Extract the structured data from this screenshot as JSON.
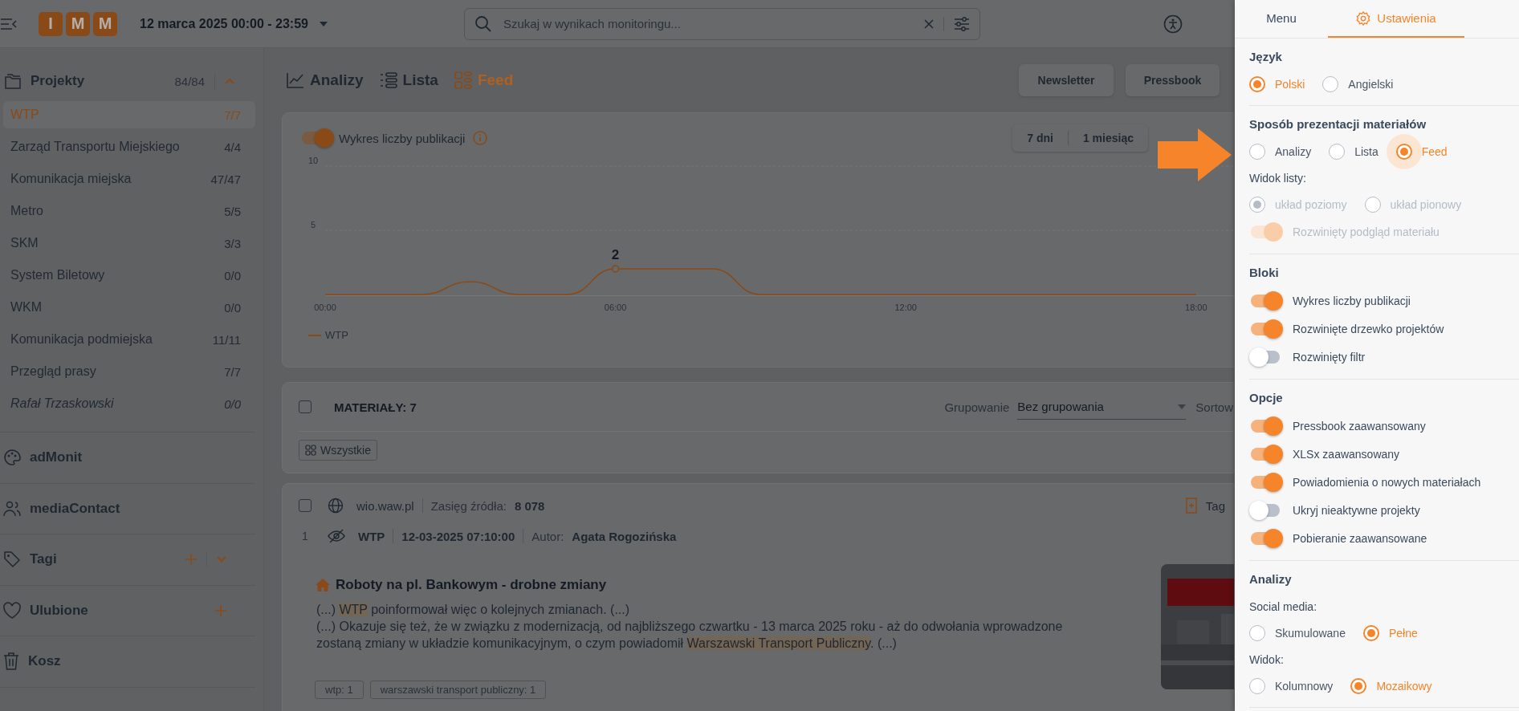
{
  "header": {
    "logo": [
      "I",
      "M",
      "M"
    ],
    "date_range": "12 marca 2025 00:00 - 23:59",
    "search": {
      "placeholder": "Szukaj w wynikach monitoringu..."
    }
  },
  "sidebar": {
    "projects": {
      "title": "Projekty",
      "count": "84/84",
      "expanded": true,
      "items": [
        {
          "name": "WTP",
          "count": "7/7",
          "selected": true,
          "inactive": false
        },
        {
          "name": "Zarząd Transportu Miejskiego",
          "count": "4/4",
          "selected": false,
          "inactive": false
        },
        {
          "name": "Komunikacja miejska",
          "count": "47/47",
          "selected": false,
          "inactive": false
        },
        {
          "name": "Metro",
          "count": "5/5",
          "selected": false,
          "inactive": false
        },
        {
          "name": "SKM",
          "count": "3/3",
          "selected": false,
          "inactive": false
        },
        {
          "name": "System Biletowy",
          "count": "0/0",
          "selected": false,
          "inactive": false
        },
        {
          "name": "WKM",
          "count": "0/0",
          "selected": false,
          "inactive": false
        },
        {
          "name": "Komunikacja podmiejska",
          "count": "11/11",
          "selected": false,
          "inactive": false
        },
        {
          "name": "Przegląd prasy",
          "count": "7/7",
          "selected": false,
          "inactive": false
        },
        {
          "name": "Rafał Trzaskowski",
          "count": "0/0",
          "selected": false,
          "inactive": true
        }
      ]
    },
    "sections": [
      {
        "kind": "admonit",
        "label": "adMonit",
        "add": false,
        "collapsible": false
      },
      {
        "kind": "contacts",
        "label": "mediaContact",
        "add": false,
        "collapsible": false
      },
      {
        "kind": "tags",
        "label": "Tagi",
        "add": true,
        "collapsible": true
      },
      {
        "kind": "favorites",
        "label": "Ulubione",
        "add": true,
        "collapsible": false
      },
      {
        "kind": "trash",
        "label": "Kosz",
        "add": false,
        "collapsible": false
      }
    ]
  },
  "view_tabs": [
    {
      "kind": "chart",
      "label": "Analizy",
      "selected": false
    },
    {
      "kind": "list",
      "label": "Lista",
      "selected": false
    },
    {
      "kind": "feed",
      "label": "Feed",
      "selected": true
    }
  ],
  "actions": [
    "Newsletter",
    "Pressbook"
  ],
  "chart_card": {
    "toggle": {
      "label": "Wykres liczby publikacji",
      "on": true
    },
    "ranges": [
      "7 dni",
      "1 miesiąc"
    ],
    "chart_data": {
      "type": "line",
      "x": [
        0,
        1,
        2,
        3,
        4,
        5,
        6,
        7,
        8,
        9,
        10,
        11,
        12,
        13,
        14,
        15,
        16,
        17,
        18
      ],
      "xlim": [
        0,
        18.8
      ],
      "ylim": [
        0,
        10
      ],
      "yticks": [
        5,
        10
      ],
      "xticks": [
        {
          "value": 0,
          "label": "00:00"
        },
        {
          "value": 6,
          "label": "06:00"
        },
        {
          "value": 12,
          "label": "12:00"
        },
        {
          "value": 18,
          "label": "18:00"
        }
      ],
      "series": [
        {
          "name": "WTP",
          "color": "#8a4a18",
          "values": [
            0,
            0,
            0,
            1,
            0,
            0,
            2,
            2,
            2,
            0,
            0,
            0,
            0,
            0,
            0,
            0,
            0,
            0,
            0
          ]
        }
      ],
      "annotations": [
        {
          "x": 6,
          "y": 2,
          "text": "2"
        }
      ]
    }
  },
  "materials": {
    "checked": false,
    "title": "MATERIAŁY: 7",
    "grouping_label": "Grupowanie",
    "grouping_value": "Bez grupowania",
    "sorting_label": "Sortow",
    "filter_chip": "Wszystkie"
  },
  "articles": [
    {
      "checked": false,
      "number": "1",
      "source": "wio.waw.pl",
      "reach_label": "Zasięg źródła:",
      "reach": "8 078",
      "tag_action": "Tag",
      "project": "WTP",
      "date": "12-03-2025 07:10:00",
      "author_label": "Autor:",
      "author": "Agata Rogozińska",
      "title": "Roboty na pl. Bankowym - drobne zmiany",
      "excerpt": [
        [
          {
            "text": "(...) ",
            "highlight": false
          },
          {
            "text": "WTP",
            "highlight": true
          },
          {
            "text": " poinformował więc o kolejnych zmianach. (...)",
            "highlight": false
          }
        ],
        [
          {
            "text": "(...) Okazuje się też, że w związku z modernizacją, od najbliższego czwartku - 13 marca 2025 roku - aż do odwołania wprowadzone zostaną zmiany w układzie komunikacyjnym, o czym powiadomił ",
            "highlight": false
          },
          {
            "text": "Warszawski Transport Publiczny",
            "highlight": true
          },
          {
            "text": ". (...)",
            "highlight": false
          }
        ]
      ],
      "tags": [
        "wtp: 1",
        "warszawski transport publiczny: 1"
      ],
      "image": {
        "kind": "picture"
      }
    }
  ],
  "settings_panel": {
    "tabs": [
      {
        "label": "Menu",
        "selected": false,
        "icon": false
      },
      {
        "label": "Ustawienia",
        "selected": true,
        "icon": true
      }
    ],
    "sections": [
      {
        "title": "Język",
        "rows": [
          {
            "kind": "radios",
            "disabled": false,
            "options": [
              {
                "label": "Polski",
                "selected": true
              },
              {
                "label": "Angielski",
                "selected": false
              }
            ]
          }
        ]
      },
      {
        "title": "Sposób prezentacji materiałów",
        "rows": [
          {
            "kind": "radios",
            "disabled": false,
            "options": [
              {
                "label": "Analizy",
                "selected": false,
                "focused": false
              },
              {
                "label": "Lista",
                "selected": false,
                "focused": false
              },
              {
                "label": "Feed",
                "selected": true,
                "focused": true
              }
            ]
          },
          {
            "kind": "label",
            "text": "Widok listy:"
          },
          {
            "kind": "radios",
            "disabled": true,
            "options": [
              {
                "label": "układ poziomy",
                "selected": true
              },
              {
                "label": "układ pionowy",
                "selected": false
              }
            ]
          },
          {
            "kind": "toggle",
            "label": "Rozwinięty podgląd materiału",
            "on": true,
            "disabled": true
          }
        ]
      },
      {
        "title": "Bloki",
        "rows": [
          {
            "kind": "toggle",
            "label": "Wykres liczby publikacji",
            "on": true,
            "disabled": false
          },
          {
            "kind": "toggle",
            "label": "Rozwinięte drzewko projektów",
            "on": true,
            "disabled": false
          },
          {
            "kind": "toggle",
            "label": "Rozwinięty filtr",
            "on": false,
            "disabled": false
          }
        ]
      },
      {
        "title": "Opcje",
        "rows": [
          {
            "kind": "toggle",
            "label": "Pressbook zaawansowany",
            "on": true,
            "disabled": false
          },
          {
            "kind": "toggle",
            "label": "XLSx zaawansowany",
            "on": true,
            "disabled": false
          },
          {
            "kind": "toggle",
            "label": "Powiadomienia o nowych materiałach",
            "on": true,
            "disabled": false
          },
          {
            "kind": "toggle",
            "label": "Ukryj nieaktywne projekty",
            "on": false,
            "disabled": false
          },
          {
            "kind": "toggle",
            "label": "Pobieranie zaawansowane",
            "on": true,
            "disabled": false
          }
        ]
      },
      {
        "title": "Analizy",
        "rows": [
          {
            "kind": "label",
            "text": "Social media:"
          },
          {
            "kind": "radios",
            "disabled": false,
            "options": [
              {
                "label": "Skumulowane",
                "selected": false
              },
              {
                "label": "Pełne",
                "selected": true
              }
            ]
          },
          {
            "kind": "label",
            "text": "Widok:"
          },
          {
            "kind": "radios",
            "disabled": false,
            "options": [
              {
                "label": "Kolumnowy",
                "selected": false
              },
              {
                "label": "Mozaikowy",
                "selected": true
              }
            ]
          }
        ]
      }
    ]
  }
}
